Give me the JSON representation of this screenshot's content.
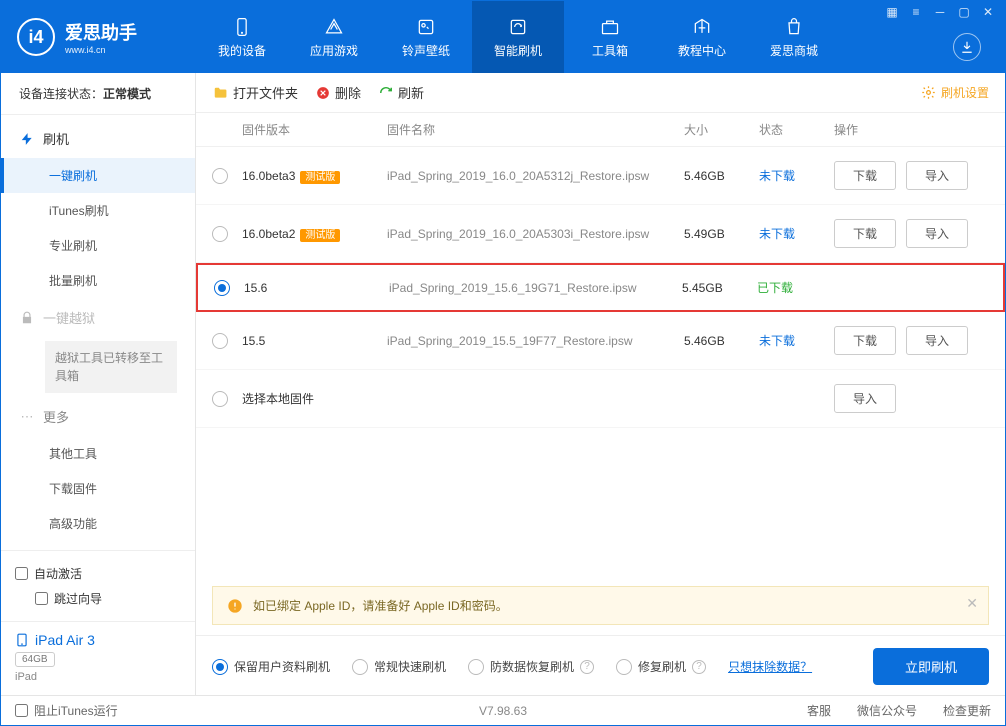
{
  "app": {
    "name": "爱思助手",
    "url": "www.i4.cn"
  },
  "nav": [
    {
      "label": "我的设备"
    },
    {
      "label": "应用游戏"
    },
    {
      "label": "铃声壁纸"
    },
    {
      "label": "智能刷机",
      "active": true
    },
    {
      "label": "工具箱"
    },
    {
      "label": "教程中心"
    },
    {
      "label": "爱思商城"
    }
  ],
  "status": {
    "prefix": "设备连接状态：",
    "mode": "正常模式"
  },
  "sidebar": {
    "groups": [
      {
        "label": "刷机",
        "items": [
          "一键刷机",
          "iTunes刷机",
          "专业刷机",
          "批量刷机"
        ]
      },
      {
        "label": "一键越狱",
        "disabled": true,
        "note": "越狱工具已转移至工具箱"
      },
      {
        "label": "更多",
        "items": [
          "其他工具",
          "下载固件",
          "高级功能"
        ]
      }
    ],
    "autoActivate": "自动激活",
    "skipGuide": "跳过向导",
    "device": {
      "name": "iPad Air 3",
      "cap": "64GB",
      "type": "iPad"
    }
  },
  "toolbar": {
    "openFolder": "打开文件夹",
    "delete": "删除",
    "refresh": "刷新",
    "settings": "刷机设置"
  },
  "table": {
    "headers": {
      "version": "固件版本",
      "name": "固件名称",
      "size": "大小",
      "status": "状态",
      "ops": "操作"
    },
    "download": "下载",
    "import": "导入",
    "rows": [
      {
        "version": "16.0beta3",
        "badge": "测试版",
        "name": "iPad_Spring_2019_16.0_20A5312j_Restore.ipsw",
        "size": "5.46GB",
        "status": "未下载",
        "selected": false,
        "showOps": true
      },
      {
        "version": "16.0beta2",
        "badge": "测试版",
        "name": "iPad_Spring_2019_16.0_20A5303i_Restore.ipsw",
        "size": "5.49GB",
        "status": "未下载",
        "selected": false,
        "showOps": true
      },
      {
        "version": "15.6",
        "name": "iPad_Spring_2019_15.6_19G71_Restore.ipsw",
        "size": "5.45GB",
        "status": "已下载",
        "selected": true,
        "highlight": true,
        "showOps": false
      },
      {
        "version": "15.5",
        "name": "iPad_Spring_2019_15.5_19F77_Restore.ipsw",
        "size": "5.46GB",
        "status": "未下载",
        "selected": false,
        "showOps": true
      },
      {
        "version": "选择本地固件",
        "name": "",
        "size": "",
        "status": "",
        "selected": false,
        "importOnly": true
      }
    ]
  },
  "notice": "如已绑定 Apple ID，请准备好 Apple ID和密码。",
  "options": {
    "opts": [
      "保留用户资料刷机",
      "常规快速刷机",
      "防数据恢复刷机",
      "修复刷机"
    ],
    "eraseLink": "只想抹除数据？",
    "flash": "立即刷机"
  },
  "footer": {
    "blockItunes": "阻止iTunes运行",
    "version": "V7.98.63",
    "links": [
      "客服",
      "微信公众号",
      "检查更新"
    ]
  }
}
